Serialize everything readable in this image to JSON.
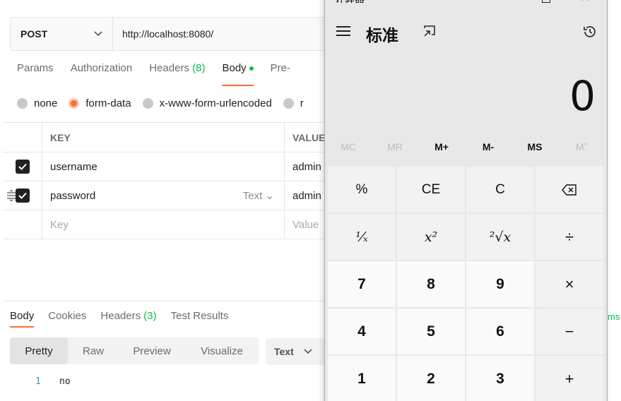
{
  "postman": {
    "request": {
      "method": "POST",
      "url": "http://localhost:8080/"
    },
    "tabs": [
      {
        "label": "Params"
      },
      {
        "label": "Authorization"
      },
      {
        "label": "Headers",
        "count": "(8)"
      },
      {
        "label": "Body",
        "active": true
      },
      {
        "label": "Pre-"
      }
    ],
    "body_types": [
      {
        "label": "none",
        "selected": false
      },
      {
        "label": "form-data",
        "selected": true
      },
      {
        "label": "x-www-form-urlencoded",
        "selected": false
      },
      {
        "label": "r",
        "selected": false
      }
    ],
    "table": {
      "headers": {
        "key": "KEY",
        "value": "VALUE"
      },
      "rows": [
        {
          "checked": true,
          "key": "username",
          "value": "admin",
          "type": ""
        },
        {
          "checked": true,
          "key": "password",
          "value": "admin",
          "type": "Text"
        }
      ],
      "placeholder": {
        "key": "Key",
        "value": "Value"
      }
    },
    "response": {
      "tabs": [
        {
          "label": "Body",
          "active": true
        },
        {
          "label": "Cookies"
        },
        {
          "label": "Headers",
          "count": "(3)"
        },
        {
          "label": "Test Results"
        }
      ],
      "ms_fragment": "ms",
      "views": [
        "Pretty",
        "Raw",
        "Preview",
        "Visualize"
      ],
      "active_view": "Pretty",
      "format": "Text",
      "lines": [
        {
          "no": "1",
          "text": "no"
        }
      ]
    },
    "colors": {
      "accent": "#ff6c37",
      "green": "#0cbb52"
    }
  },
  "calculator": {
    "title": "计算器",
    "mode": "标准",
    "display": "0",
    "memory": [
      "MC",
      "MR",
      "M+",
      "M-",
      "MS",
      "Mˇ"
    ],
    "keys": [
      "%",
      "CE",
      "C",
      "⌫",
      "¹⁄ₓ",
      "x²",
      "²√x",
      "÷",
      "7",
      "8",
      "9",
      "×",
      "4",
      "5",
      "6",
      "−",
      "1",
      "2",
      "3",
      "+"
    ]
  }
}
